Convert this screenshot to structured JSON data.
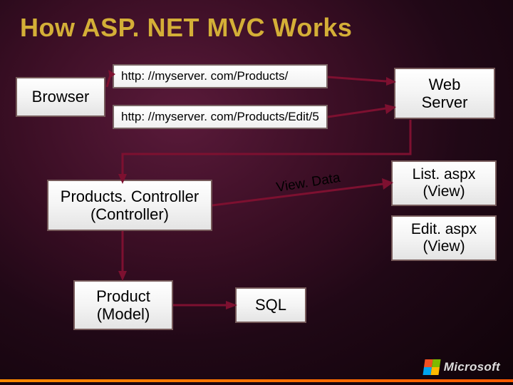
{
  "title": "How ASP. NET MVC Works",
  "boxes": {
    "browser": "Browser",
    "web_server": "Web\nServer",
    "controller": "Products. Controller\n(Controller)",
    "model": "Product\n(Model)",
    "view_list": "List. aspx\n(View)",
    "view_edit": "Edit. aspx\n(View)",
    "sql": "SQL"
  },
  "urls": {
    "request": "http: //myserver. com/Products/",
    "edit": "http: //myserver. com/Products/Edit/5"
  },
  "labels": {
    "viewdata": "View. Data"
  },
  "logo": "Microsoft"
}
